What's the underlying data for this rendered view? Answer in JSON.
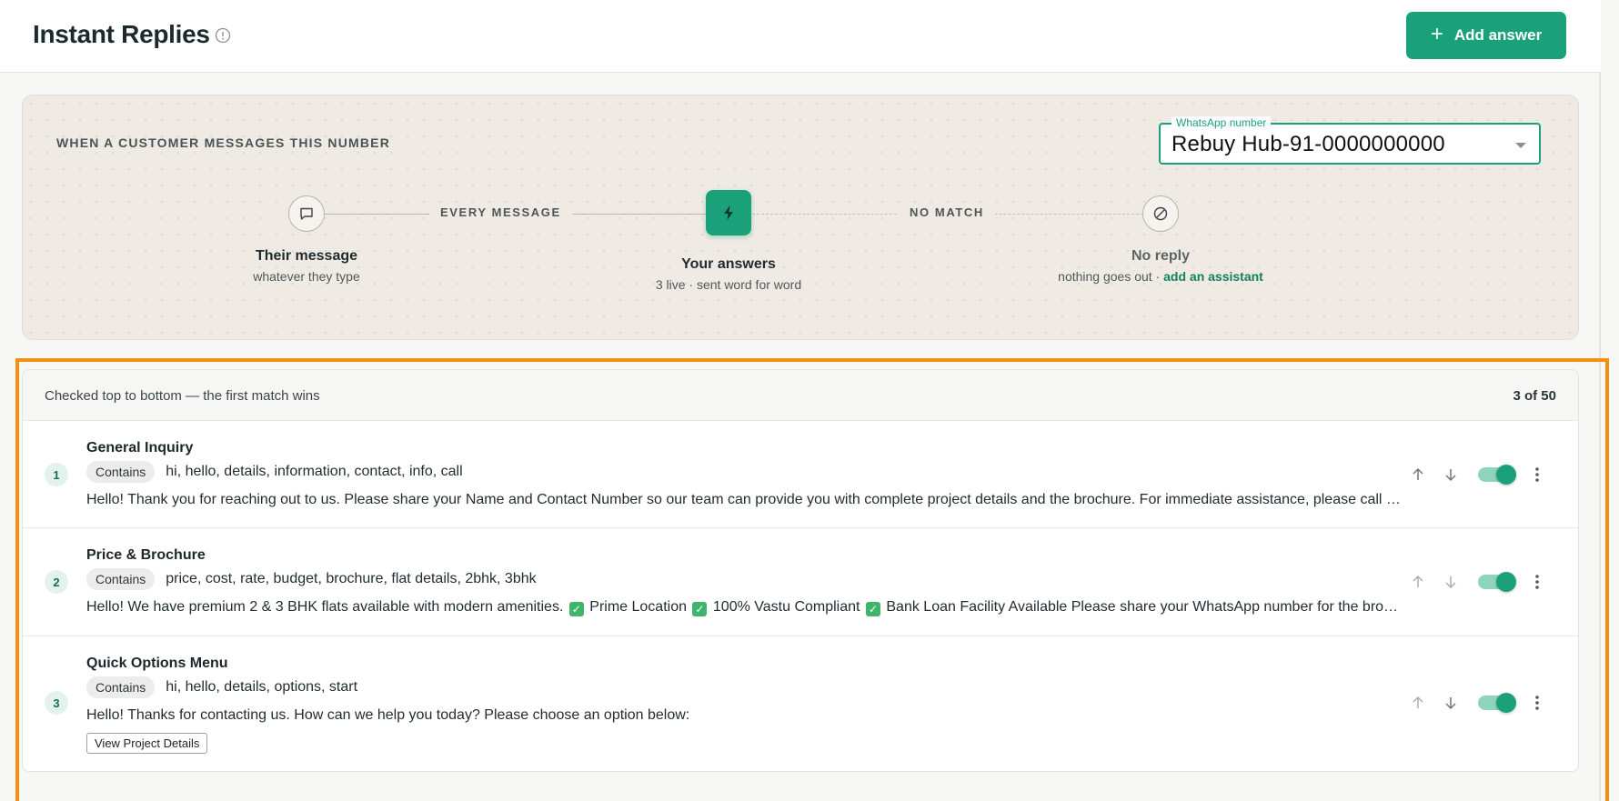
{
  "header": {
    "title": "Instant Replies",
    "add_button_label": "Add answer"
  },
  "flow": {
    "heading": "WHEN A CUSTOMER MESSAGES THIS NUMBER",
    "whatsapp_select": {
      "legend": "WhatsApp number",
      "value": "Rebuy Hub-91-0000000000"
    },
    "edge_labels": [
      "EVERY MESSAGE",
      "NO MATCH"
    ],
    "nodes": [
      {
        "title": "Their message",
        "subtitle": "whatever they type",
        "icon": "message-icon"
      },
      {
        "title": "Your answers",
        "subtitle": "3 live · sent word for word",
        "icon": "lightning-icon"
      },
      {
        "title": "No reply",
        "subtitle": "nothing goes out · ",
        "link": "add an assistant",
        "icon": "blocked-icon"
      }
    ]
  },
  "rules": {
    "caption": "Checked top to bottom — the first match wins",
    "count": "3 of 50",
    "match_label": "Contains",
    "items": [
      {
        "number": "1",
        "title": "General Inquiry",
        "keywords": "hi, hello, details, information, contact, info, call",
        "preview": "Hello! Thank you for reaching out to us. Please share your Name and Contact Number so our team can provide you with complete project details and the brochure. For immediate assistance, please call us.",
        "enabled": true
      },
      {
        "number": "2",
        "title": "Price & Brochure",
        "keywords": "price, cost, rate, budget, brochure, flat details, 2bhk, 3bhk",
        "preview_parts": [
          "Hello! We have premium 2 & 3 BHK flats available with modern amenities. ",
          "Prime Location ",
          "100% Vastu Compliant ",
          "Bank Loan Facility Available Please share your WhatsApp number for the brochure."
        ],
        "enabled": true
      },
      {
        "number": "3",
        "title": "Quick Options Menu",
        "keywords": "hi, hello, details, options, start",
        "preview": "Hello! Thanks for contacting us. How can we help you today? Please choose an option below:",
        "option_button": "View Project Details",
        "enabled": true
      }
    ]
  },
  "colors": {
    "accent": "#1aa17a",
    "highlight_frame": "#f39012",
    "flow_panel_bg": "#efebe4"
  }
}
